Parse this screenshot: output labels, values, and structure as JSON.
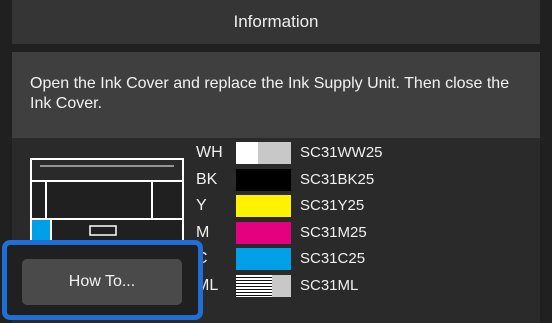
{
  "header": {
    "title": "Information"
  },
  "message": {
    "text": "Open the Ink Cover and replace the Ink Supply Unit. Then close the Ink Cover."
  },
  "inks": [
    {
      "code": "WH",
      "name": "SC31WW25",
      "color": "#ffffff",
      "level": 0.4,
      "style": "partial"
    },
    {
      "code": "BK",
      "name": "SC31BK25",
      "color": "#000000",
      "level": 1.0,
      "style": "solid"
    },
    {
      "code": "Y",
      "name": "SC31Y25",
      "color": "#fff200",
      "level": 1.0,
      "style": "solid"
    },
    {
      "code": "M",
      "name": "SC31M25",
      "color": "#e4007f",
      "level": 1.0,
      "style": "solid"
    },
    {
      "code": "C",
      "name": "SC31C25",
      "color": "#00a0e9",
      "level": 1.0,
      "style": "solid"
    },
    {
      "code": "ML",
      "name": "SC31ML",
      "color": "#ffffff",
      "level": 0.65,
      "style": "striped"
    }
  ],
  "printer": {
    "highlight_slot_color": "#00a0e9"
  },
  "actions": {
    "howto_label": "How To..."
  },
  "colors": {
    "highlight_border": "#1f6fd6"
  }
}
